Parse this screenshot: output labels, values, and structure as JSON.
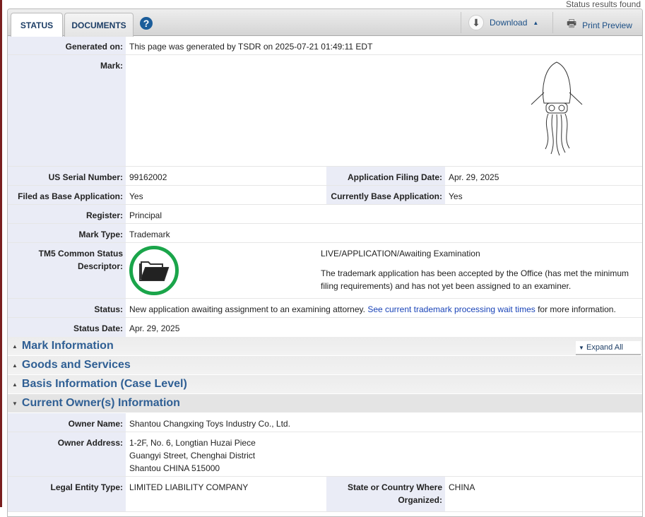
{
  "top_note": "Status results found",
  "tabs": {
    "status": "STATUS",
    "documents": "DOCUMENTS",
    "help": "?"
  },
  "toolbar": {
    "download": "Download",
    "print": "Print Preview"
  },
  "rows": {
    "generated": {
      "label": "Generated on:",
      "value": "This page was generated by TSDR on 2025-07-21 01:49:11 EDT"
    },
    "mark": {
      "label": "Mark:"
    },
    "serial": {
      "label": "US Serial Number:",
      "value": "99162002"
    },
    "filing_date": {
      "label": "Application Filing Date:",
      "value": "Apr. 29, 2025"
    },
    "filed_base": {
      "label": "Filed as Base Application:",
      "value": "Yes"
    },
    "current_base": {
      "label": "Currently Base Application:",
      "value": "Yes"
    },
    "register": {
      "label": "Register:",
      "value": "Principal"
    },
    "mark_type": {
      "label": "Mark Type:",
      "value": "Trademark"
    },
    "tm5": {
      "label": "TM5 Common Status Descriptor:",
      "title": "LIVE/APPLICATION/Awaiting Examination",
      "description": "The trademark application has been accepted by the Office (has met the minimum filing requirements) and has not yet been assigned to an examiner."
    },
    "status": {
      "label": "Status:",
      "text": "New application awaiting assignment to an examining attorney. ",
      "link": "See current trademark processing wait times",
      "suffix": " for more information."
    },
    "status_date": {
      "label": "Status Date:",
      "value": "Apr. 29, 2025"
    }
  },
  "sections": [
    "Mark Information",
    "Goods and Services",
    "Basis Information (Case Level)",
    "Current Owner(s) Information"
  ],
  "expand_all": "Expand All",
  "owner": {
    "name": {
      "label": "Owner Name:",
      "value": "Shantou Changxing Toys Industry Co., Ltd."
    },
    "address": {
      "label": "Owner Address:",
      "lines": [
        "1-2F, No. 6, Longtian Huzai Piece",
        "Guangyi Street, Chenghai District",
        "Shantou CHINA 515000"
      ]
    },
    "entity": {
      "label": "Legal Entity Type:",
      "value": "LIMITED LIABILITY COMPANY"
    },
    "state": {
      "label": "State or Country Where Organized:",
      "value": "CHINA"
    }
  }
}
